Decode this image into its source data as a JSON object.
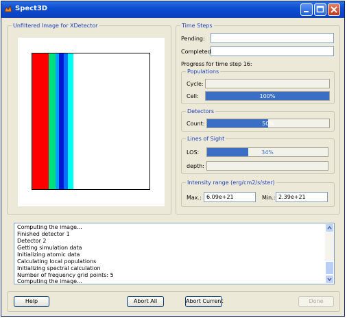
{
  "window": {
    "title": "Spect3D",
    "icon": "spect3d-app-icon",
    "controls": [
      "minimize-icon",
      "maximize-icon",
      "close-icon"
    ]
  },
  "image_panel": {
    "title": "Unfiltered Image for XDetector",
    "stripe_colors": [
      "#ff0000",
      "#00e07a",
      "#00a0ff",
      "#0018d0",
      "#0070ff",
      "#00ffee",
      "#ffffff"
    ]
  },
  "time_steps": {
    "title": "Time Steps",
    "pending_label": "Pending:",
    "pending_value": "",
    "completed_label": "Completed:",
    "completed_value": "",
    "progress_text": "Progress for time step 16:"
  },
  "populations": {
    "title": "Populations",
    "cycle_label": "Cycle:",
    "cycle_text": "",
    "cycle_fraction": 0,
    "cell_label": "Cell:",
    "cell_text": "100%",
    "cell_fraction": 1.0
  },
  "detectors": {
    "title": "Detectors",
    "count_label": "Count:",
    "count_text": "50%",
    "count_fraction": 0.5
  },
  "lines_of_sight": {
    "title": "Lines of Sight",
    "los_label": "LOS:",
    "los_text": "34%",
    "los_fraction": 0.34,
    "depth_label": "depth:",
    "depth_text": "",
    "depth_fraction": 0
  },
  "intensity": {
    "title": "Intensity range (erg/cm2/s/ster)",
    "max_label": "Max.:",
    "max_value": "6.09e+21",
    "min_label": "Min.:",
    "min_value": "2.39e+21"
  },
  "log": {
    "lines": [
      "Computing the image...",
      " Finished detector 1",
      " Detector 2",
      "Getting simulation data",
      "Initializing atomic data",
      "Calculating local populations",
      "Initializing spectral calculation",
      "Number of frequency grid points: 5",
      "Computing the image..."
    ]
  },
  "buttons": {
    "help": "Help",
    "abort_all": "Abort All",
    "abort_current": "Abort Current",
    "done": "Done"
  }
}
